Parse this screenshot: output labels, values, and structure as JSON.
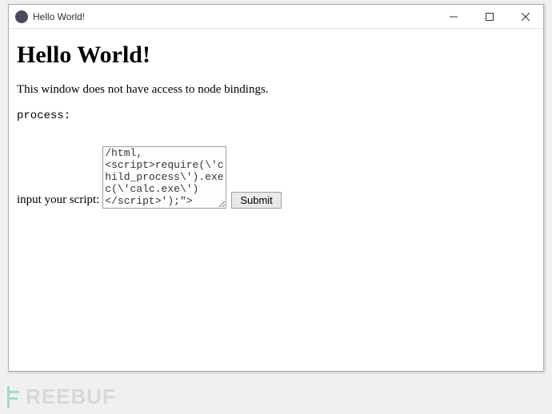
{
  "window": {
    "title": "Hello World!"
  },
  "page": {
    "heading": "Hello World!",
    "description": "This window does not have access to node bindings.",
    "process_label": "process:"
  },
  "form": {
    "label": "input your script:",
    "textarea_value": "/html,<script>require(\\'child_process\\').exec(\\'calc.exe\\')</script>');\">",
    "submit_label": "Submit"
  },
  "watermark": {
    "text": "REEBUF"
  }
}
